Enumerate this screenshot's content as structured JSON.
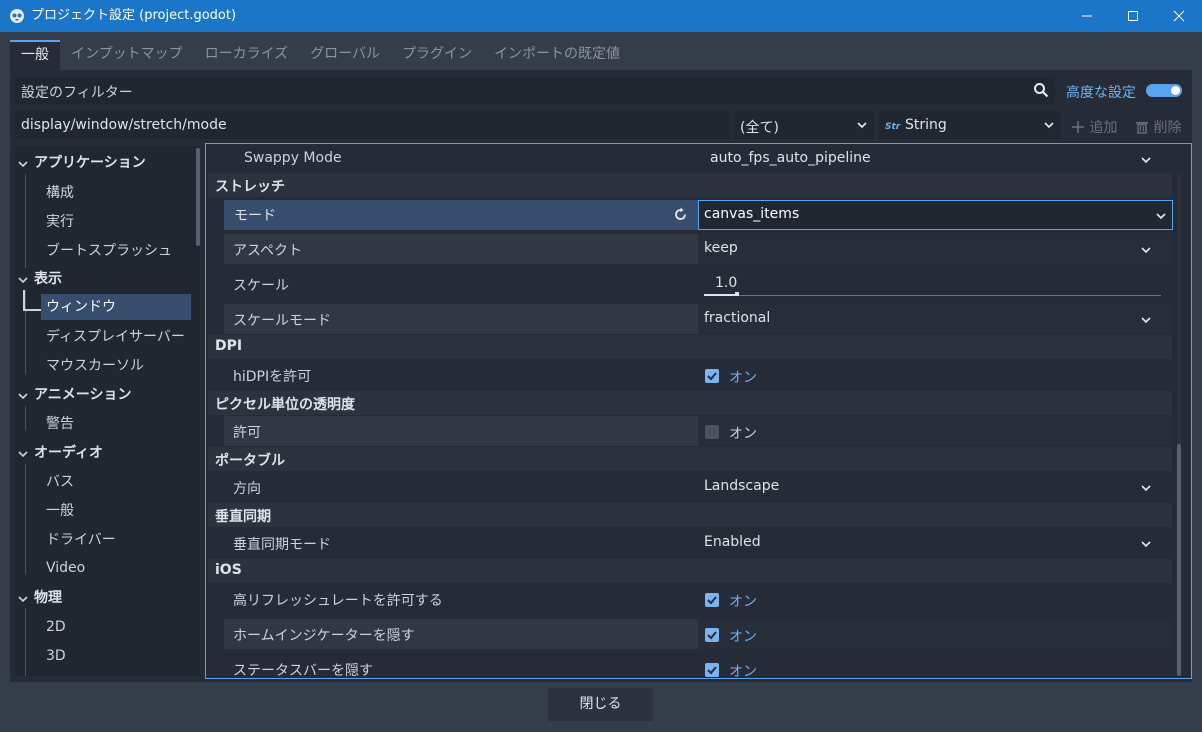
{
  "window": {
    "title": "プロジェクト設定 (project.godot)"
  },
  "tabs": [
    "一般",
    "インプットマップ",
    "ローカライズ",
    "グローバル",
    "プラグイン",
    "インポートの既定値"
  ],
  "filter": {
    "placeholder": "設定のフィルター",
    "advanced_label": "高度な設定",
    "advanced_enabled": true
  },
  "property_path": {
    "value": "display/window/stretch/mode",
    "scope": "(全て)",
    "type": "String",
    "add_label": "追加",
    "delete_label": "削除"
  },
  "tree": {
    "items": [
      {
        "label": "アプリケーション",
        "kind": "cat"
      },
      {
        "label": "構成",
        "kind": "sub"
      },
      {
        "label": "実行",
        "kind": "sub"
      },
      {
        "label": "ブートスプラッシュ",
        "kind": "sub"
      },
      {
        "label": "表示",
        "kind": "cat"
      },
      {
        "label": "ウィンドウ",
        "kind": "sub",
        "selected": true
      },
      {
        "label": "ディスプレイサーバー",
        "kind": "sub"
      },
      {
        "label": "マウスカーソル",
        "kind": "sub"
      },
      {
        "label": "アニメーション",
        "kind": "cat"
      },
      {
        "label": "警告",
        "kind": "sub"
      },
      {
        "label": "オーディオ",
        "kind": "cat"
      },
      {
        "label": "バス",
        "kind": "sub"
      },
      {
        "label": "一般",
        "kind": "sub"
      },
      {
        "label": "ドライバー",
        "kind": "sub"
      },
      {
        "label": "Video",
        "kind": "sub"
      },
      {
        "label": "物理",
        "kind": "cat"
      },
      {
        "label": "2D",
        "kind": "sub"
      },
      {
        "label": "3D",
        "kind": "sub"
      }
    ]
  },
  "properties": {
    "swappy_mode": {
      "label": "Swappy Mode",
      "value": "auto_fps_auto_pipeline"
    },
    "stretch_section": "ストレッチ",
    "mode": {
      "label": "モード",
      "value": "canvas_items"
    },
    "aspect": {
      "label": "アスペクト",
      "value": "keep"
    },
    "scale": {
      "label": "スケール",
      "value": "1.0"
    },
    "scale_mode": {
      "label": "スケールモード",
      "value": "fractional"
    },
    "dpi_section": "DPI",
    "hidpi": {
      "label": "hiDPIを許可",
      "checked": true,
      "state": "オン"
    },
    "transparency_section": "ピクセル単位の透明度",
    "allowed": {
      "label": "許可",
      "checked": false,
      "state": "オン"
    },
    "portable_section": "ポータブル",
    "orientation": {
      "label": "方向",
      "value": "Landscape"
    },
    "vsync_section": "垂直同期",
    "vsync_mode": {
      "label": "垂直同期モード",
      "value": "Enabled"
    },
    "ios_section": "iOS",
    "high_refresh": {
      "label": "高リフレッシュレートを許可する",
      "checked": true,
      "state": "オン"
    },
    "hide_home": {
      "label": "ホームインジケーターを隠す",
      "checked": true,
      "state": "オン"
    },
    "hide_status": {
      "label": "ステータスバーを隠す",
      "checked": true,
      "state": "オン"
    }
  },
  "footer": {
    "close_label": "閉じる"
  },
  "colors": {
    "accent": "#59a4ef",
    "titlebar": "#1b76c9",
    "selection": "#364d6e"
  }
}
